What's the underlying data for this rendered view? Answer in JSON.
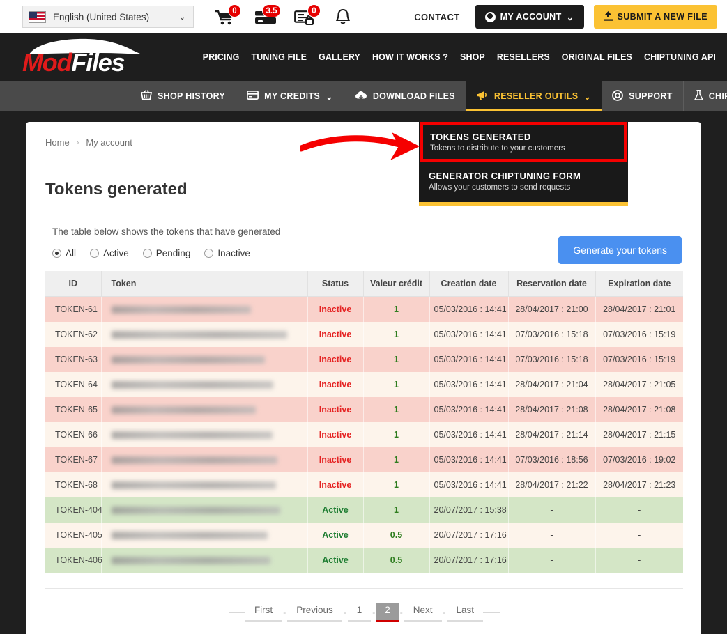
{
  "topbar": {
    "language": "English (United States)",
    "flag_icon": "us-flag-icon",
    "chevron": "⌄",
    "icons": [
      {
        "name": "shopping-cart-icon",
        "badge": "0"
      },
      {
        "name": "credit-card-icon",
        "badge": "3.5"
      },
      {
        "name": "locked-document-icon",
        "badge": "0"
      },
      {
        "name": "notification-bell-icon",
        "badge": ""
      }
    ],
    "contact_label": "CONTACT",
    "account_label": "MY ACCOUNT",
    "account_chevron": "⌄",
    "submit_label": "SUBMIT A NEW FILE"
  },
  "brand": {
    "name_red": "Mod",
    "name_white": "Files"
  },
  "mainnav": [
    {
      "label": "PRICING"
    },
    {
      "label": "TUNING FILE"
    },
    {
      "label": "GALLERY"
    },
    {
      "label": "HOW IT WORKS ?"
    },
    {
      "label": "SHOP"
    },
    {
      "label": "RESELLERS"
    },
    {
      "label": "ORIGINAL FILES"
    },
    {
      "label": "CHIPTUNING API"
    }
  ],
  "subnav": [
    {
      "label": "SHOP HISTORY",
      "icon": "basket-icon",
      "caret": "",
      "active": false
    },
    {
      "label": "MY CREDITS",
      "icon": "card-icon",
      "caret": "⌄",
      "active": false
    },
    {
      "label": "DOWNLOAD FILES",
      "icon": "cloud-download-icon",
      "caret": "",
      "active": false
    },
    {
      "label": "RESELLER OUTILS",
      "icon": "megaphone-icon",
      "caret": "⌄",
      "active": true
    },
    {
      "label": "SUPPORT",
      "icon": "lifebuoy-icon",
      "caret": "",
      "active": false
    },
    {
      "label": "CHIPTUNING API",
      "icon": "flask-icon",
      "caret": "⌄",
      "active": false
    }
  ],
  "dropdown": {
    "items": [
      {
        "title": "TOKENS GENERATED",
        "subtitle": "Tokens to distribute to your customers",
        "highlighted": true
      },
      {
        "title": "GENERATOR CHIPTUNING FORM",
        "subtitle": "Allows your customers to send requests",
        "highlighted": false
      }
    ],
    "highlight_color": "#f50000",
    "accent_color": "#fbc233"
  },
  "breadcrumb": {
    "home": "Home",
    "separator": "›",
    "current": "My account"
  },
  "page": {
    "title": "Tokens generated",
    "description": "The table below shows the tokens that have generated",
    "generate_button": "Generate your tokens"
  },
  "filters": [
    {
      "label": "All",
      "selected": true
    },
    {
      "label": "Active",
      "selected": false
    },
    {
      "label": "Pending",
      "selected": false
    },
    {
      "label": "Inactive",
      "selected": false
    }
  ],
  "table": {
    "columns": [
      "ID",
      "Token",
      "Status",
      "Valeur crédit",
      "Creation date",
      "Reservation date",
      "Expiration date"
    ],
    "rows": [
      {
        "id": "TOKEN-61",
        "token": "",
        "token_w": 200,
        "status": "Inactive",
        "credit": "1",
        "creation": "05/03/2016 : 14:41",
        "reservation": "28/04/2017 : 21:00",
        "expiration": "28/04/2017 : 21:01",
        "tone": "pink"
      },
      {
        "id": "TOKEN-62",
        "token": "",
        "token_w": 252,
        "status": "Inactive",
        "credit": "1",
        "creation": "05/03/2016 : 14:41",
        "reservation": "07/03/2016 : 15:18",
        "expiration": "07/03/2016 : 15:19",
        "tone": "cream"
      },
      {
        "id": "TOKEN-63",
        "token": "",
        "token_w": 220,
        "status": "Inactive",
        "credit": "1",
        "creation": "05/03/2016 : 14:41",
        "reservation": "07/03/2016 : 15:18",
        "expiration": "07/03/2016 : 15:19",
        "tone": "pink"
      },
      {
        "id": "TOKEN-64",
        "token": "",
        "token_w": 232,
        "status": "Inactive",
        "credit": "1",
        "creation": "05/03/2016 : 14:41",
        "reservation": "28/04/2017 : 21:04",
        "expiration": "28/04/2017 : 21:05",
        "tone": "cream"
      },
      {
        "id": "TOKEN-65",
        "token": "",
        "token_w": 207,
        "status": "Inactive",
        "credit": "1",
        "creation": "05/03/2016 : 14:41",
        "reservation": "28/04/2017 : 21:08",
        "expiration": "28/04/2017 : 21:08",
        "tone": "pink"
      },
      {
        "id": "TOKEN-66",
        "token": "",
        "token_w": 231,
        "status": "Inactive",
        "credit": "1",
        "creation": "05/03/2016 : 14:41",
        "reservation": "28/04/2017 : 21:14",
        "expiration": "28/04/2017 : 21:15",
        "tone": "cream"
      },
      {
        "id": "TOKEN-67",
        "token": "",
        "token_w": 238,
        "status": "Inactive",
        "credit": "1",
        "creation": "05/03/2016 : 14:41",
        "reservation": "07/03/2016 : 18:56",
        "expiration": "07/03/2016 : 19:02",
        "tone": "pink"
      },
      {
        "id": "TOKEN-68",
        "token": "",
        "token_w": 236,
        "status": "Inactive",
        "credit": "1",
        "creation": "05/03/2016 : 14:41",
        "reservation": "28/04/2017 : 21:22",
        "expiration": "28/04/2017 : 21:23",
        "tone": "cream"
      },
      {
        "id": "TOKEN-404",
        "token": "",
        "token_w": 242,
        "status": "Active",
        "credit": "1",
        "creation": "20/07/2017 : 15:38",
        "reservation": "-",
        "expiration": "-",
        "tone": "green"
      },
      {
        "id": "TOKEN-405",
        "token": "",
        "token_w": 224,
        "status": "Active",
        "credit": "0.5",
        "creation": "20/07/2017 : 17:16",
        "reservation": "-",
        "expiration": "-",
        "tone": "cream"
      },
      {
        "id": "TOKEN-406",
        "token": "",
        "token_w": 228,
        "status": "Active",
        "credit": "0.5",
        "creation": "20/07/2017 : 17:16",
        "reservation": "-",
        "expiration": "-",
        "tone": "green"
      }
    ]
  },
  "pagination": {
    "first": "First",
    "previous": "Previous",
    "pages": [
      "1",
      "2"
    ],
    "current": "2",
    "next": "Next",
    "last": "Last",
    "dash": "-"
  }
}
